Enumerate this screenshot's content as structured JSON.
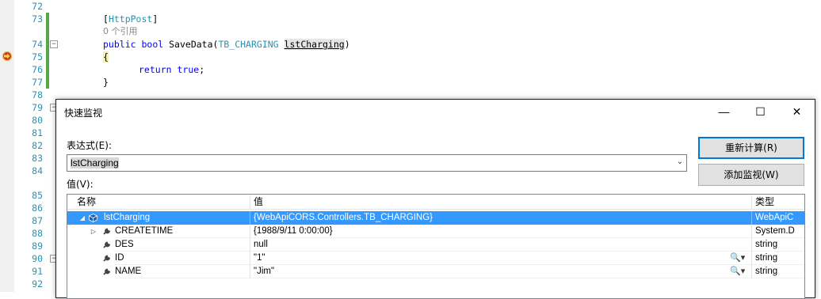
{
  "editor": {
    "lines": [
      {
        "num": "72",
        "text": ""
      },
      {
        "num": "73",
        "text": "[HttpPost]"
      },
      {
        "num": "",
        "text": "0 个引用"
      },
      {
        "num": "74",
        "text": "public bool SaveData(TB_CHARGING lstCharging)"
      },
      {
        "num": "75",
        "text": "{"
      },
      {
        "num": "76",
        "text": "return true;"
      },
      {
        "num": "77",
        "text": "}"
      },
      {
        "num": "78",
        "text": ""
      },
      {
        "num": "79",
        "text": ""
      },
      {
        "num": "80",
        "text": ""
      },
      {
        "num": "81",
        "text": ""
      },
      {
        "num": "82",
        "text": ""
      },
      {
        "num": "83",
        "text": ""
      },
      {
        "num": "84",
        "text": ""
      },
      {
        "num": "85",
        "text": ""
      },
      {
        "num": "86",
        "text": ""
      },
      {
        "num": "87",
        "text": ""
      },
      {
        "num": "88",
        "text": ""
      },
      {
        "num": "89",
        "text": ""
      },
      {
        "num": "90",
        "text": ""
      },
      {
        "num": "91",
        "text": ""
      },
      {
        "num": "92",
        "text": ""
      }
    ],
    "attr_name": "HttpPost",
    "ref_count": "0 个引用",
    "kw_public": "public",
    "kw_bool": "bool",
    "method_name": "SaveData(",
    "param_type": "TB_CHARGING",
    "param_name": "lstCharging",
    "close_paren": ")",
    "kw_return": "return",
    "kw_true": "true",
    "semicolon": ";",
    "open_brace": "{",
    "close_brace": "}",
    "bracket_open": "[",
    "bracket_close": "]"
  },
  "dialog": {
    "title": "快速监视",
    "minimize": "—",
    "maximize": "☐",
    "close": "✕",
    "expression_label": "表达式(E):",
    "expression_value": "lstCharging",
    "value_label": "值(V):",
    "recalc_button": "重新计算(R)",
    "add_watch_button": "添加监视(W)",
    "columns": {
      "name": "名称",
      "value": "值",
      "type": "类型"
    },
    "rows": [
      {
        "name": "lstCharging",
        "value": "{WebApiCORS.Controllers.TB_CHARGING}",
        "type": "WebApiC",
        "expander": "◢",
        "icon": "object-icon",
        "selected": true
      },
      {
        "name": "CREATETIME",
        "value": "{1988/9/11 0:00:00}",
        "type": "System.D",
        "expander": "▷",
        "icon": "wrench-icon",
        "selected": false
      },
      {
        "name": "DES",
        "value": "null",
        "type": "string",
        "expander": "",
        "icon": "wrench-icon",
        "selected": false
      },
      {
        "name": "ID",
        "value": "\"1\"",
        "type": "string",
        "expander": "",
        "icon": "wrench-icon",
        "selected": false,
        "magnifier": "🔍▾"
      },
      {
        "name": "NAME",
        "value": "\"Jim\"",
        "type": "string",
        "expander": "",
        "icon": "wrench-icon",
        "selected": false,
        "magnifier": "🔍▾"
      }
    ]
  },
  "colors": {
    "selection": "#3399ff",
    "keyword": "#0000ff",
    "type": "#2b91af",
    "change_bar": "#57a64a",
    "accent_button_border": "#0078d7"
  }
}
